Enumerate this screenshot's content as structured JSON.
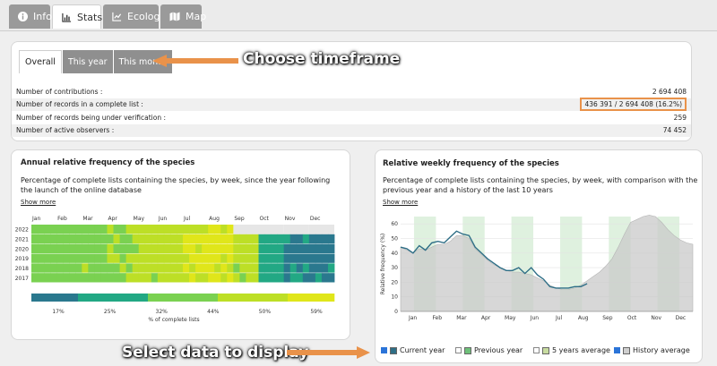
{
  "tabs": [
    {
      "label": "Info",
      "icon": "info-icon"
    },
    {
      "label": "Stats",
      "icon": "bar-chart-icon"
    },
    {
      "label": "Ecology",
      "icon": "line-chart-icon"
    },
    {
      "label": "Map",
      "icon": "map-icon"
    }
  ],
  "summary": {
    "timeframe_tabs": [
      "Overall",
      "This year",
      "This month"
    ],
    "rows": [
      {
        "label": "Number of contributions :",
        "value": "2 694 408"
      },
      {
        "label": "Number of records in a complete list :",
        "value": "436 391 / 2 694 408 (16.2%)"
      },
      {
        "label": "Number of records being under verification :",
        "value": "259"
      },
      {
        "label": "Number of active observers :",
        "value": "74 452"
      }
    ]
  },
  "callouts": {
    "timeframe": "Choose timeframe",
    "data": "Select data to display"
  },
  "annual_panel": {
    "title": "Annual relative frequency of the species",
    "desc": "Percentage of complete lists containing the species, by week, since the year following the launch of the online database",
    "show_more": "Show more",
    "months": [
      "Jan",
      "Feb",
      "Mar",
      "Apr",
      "May",
      "Jun",
      "Jul",
      "Aug",
      "Sep",
      "Oct",
      "Nov",
      "Dec"
    ],
    "years": [
      "2022",
      "2021",
      "2020",
      "2019",
      "2018",
      "2017"
    ],
    "scale_ticks": [
      "17%",
      "25%",
      "32%",
      "44%",
      "50%",
      "59%"
    ],
    "scale_label": "% of complete lists"
  },
  "weekly_panel": {
    "title": "Relative weekly frequency of the species",
    "desc": "Percentage of complete lists containing the species, by week, with comparison with the previous year and a history of the last 10 years",
    "show_more": "Show more",
    "ylabel": "Relative frequency (%)",
    "legend": [
      {
        "label": "Current year",
        "checked": true,
        "color": "#2e6e86"
      },
      {
        "label": "Previous year",
        "checked": false,
        "color": "#6ec07a"
      },
      {
        "label": "5 years average",
        "checked": false,
        "color": "#c8dca0"
      },
      {
        "label": "History average",
        "checked": true,
        "color": "#cfcfcf"
      }
    ]
  },
  "chart_data": [
    {
      "type": "heatmap",
      "title": "Annual relative frequency of the species",
      "xlabel": "",
      "ylabel": "",
      "x_categories": [
        "Jan",
        "Feb",
        "Mar",
        "Apr",
        "May",
        "Jun",
        "Jul",
        "Aug",
        "Sep",
        "Oct",
        "Nov",
        "Dec"
      ],
      "y_categories": [
        "2022",
        "2021",
        "2020",
        "2019",
        "2018",
        "2017"
      ],
      "color_scale_label": "% of complete lists",
      "color_scale_ticks": [
        "17%",
        "25%",
        "32%",
        "44%",
        "50%",
        "59%"
      ],
      "values": [
        [
          40,
          38,
          40,
          42,
          45,
          48,
          50,
          52,
          null,
          null,
          null,
          null
        ],
        [
          38,
          36,
          39,
          42,
          46,
          49,
          54,
          55,
          48,
          30,
          24,
          22
        ],
        [
          37,
          37,
          38,
          41,
          44,
          48,
          52,
          54,
          46,
          28,
          23,
          21
        ],
        [
          39,
          38,
          40,
          43,
          45,
          49,
          53,
          53,
          45,
          29,
          22,
          22
        ],
        [
          40,
          38,
          41,
          42,
          46,
          48,
          52,
          52,
          44,
          30,
          24,
          23
        ],
        [
          38,
          37,
          39,
          41,
          44,
          47,
          51,
          52,
          44,
          31,
          25,
          24
        ]
      ]
    },
    {
      "type": "line",
      "title": "Relative weekly frequency of the species",
      "ylabel": "Relative frequency (%)",
      "ylim": [
        0,
        65
      ],
      "yticks": [
        0,
        10,
        20,
        30,
        40,
        50,
        60
      ],
      "x_categories": [
        "Jan",
        "Feb",
        "Mar",
        "Apr",
        "May",
        "Jun",
        "Jul",
        "Aug",
        "Sep",
        "Oct",
        "Nov",
        "Dec"
      ],
      "series": [
        {
          "name": "Current year",
          "values": [
            44,
            43,
            40,
            45,
            42,
            47,
            48,
            47,
            51,
            55,
            53,
            52,
            44,
            40,
            36,
            33,
            30,
            28,
            28,
            30,
            26,
            30,
            25,
            22,
            17,
            16,
            16,
            16,
            17,
            17,
            19
          ]
        },
        {
          "name": "History average",
          "values": [
            44,
            42,
            40,
            43,
            42,
            44,
            46,
            46,
            48,
            52,
            52,
            50,
            43,
            39,
            35,
            32,
            30,
            28,
            27,
            27,
            26,
            25,
            23,
            21,
            18,
            16,
            15,
            15,
            16,
            18,
            21,
            24,
            27,
            31,
            36,
            44,
            53,
            61,
            63,
            65,
            66,
            65,
            61,
            56,
            52,
            49,
            47,
            46
          ]
        }
      ]
    }
  ]
}
